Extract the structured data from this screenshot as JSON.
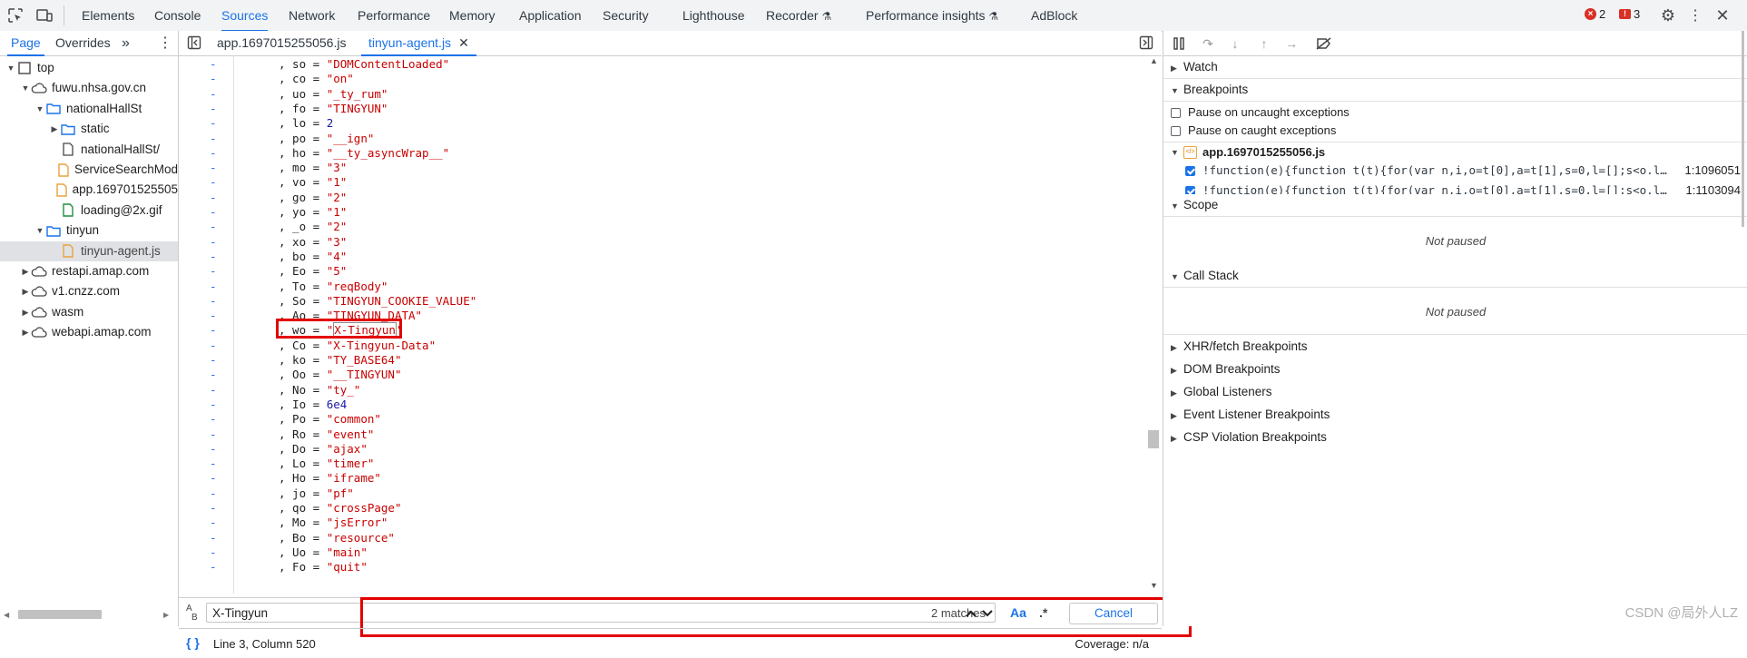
{
  "toolbar": {
    "tabs": [
      "Elements",
      "Console",
      "Sources",
      "Network",
      "Performance",
      "Memory",
      "Application",
      "Security",
      "Lighthouse",
      "Recorder",
      "Performance insights",
      "AdBlock"
    ],
    "active_tab": "Sources",
    "errors_count": "2",
    "issues_count": "3",
    "accent_color": "#1a73e8",
    "error_color": "#d93025"
  },
  "navigator": {
    "tabs": [
      "Page",
      "Overrides"
    ],
    "more": "»",
    "tree": [
      {
        "label": "top",
        "icon": "frame-icon",
        "depth": 0,
        "expanded": true
      },
      {
        "label": "fuwu.nhsa.gov.cn",
        "icon": "cloud-icon",
        "depth": 1,
        "expanded": true
      },
      {
        "label": "nationalHallSt",
        "icon": "folder-icon",
        "depth": 2,
        "expanded": true
      },
      {
        "label": "static",
        "icon": "folder-icon",
        "depth": 3,
        "expanded": false
      },
      {
        "label": "nationalHallSt/",
        "icon": "file-icon",
        "depth": 3
      },
      {
        "label": "ServiceSearchMod",
        "icon": "file-orange-icon",
        "depth": 3
      },
      {
        "label": "app.169701525505",
        "icon": "file-orange-icon",
        "depth": 3
      },
      {
        "label": "loading@2x.gif",
        "icon": "file-image-icon",
        "depth": 3
      },
      {
        "label": "tinyun",
        "icon": "folder-icon",
        "depth": 2,
        "expanded": true
      },
      {
        "label": "tinyun-agent.js",
        "icon": "file-orange-icon",
        "depth": 3,
        "selected": true
      },
      {
        "label": "restapi.amap.com",
        "icon": "cloud-icon",
        "depth": 1,
        "expanded": false
      },
      {
        "label": "v1.cnzz.com",
        "icon": "cloud-icon",
        "depth": 1,
        "expanded": false
      },
      {
        "label": "wasm",
        "icon": "cloud-icon",
        "depth": 1,
        "expanded": false
      },
      {
        "label": "webapi.amap.com",
        "icon": "cloud-icon",
        "depth": 1,
        "expanded": false
      }
    ]
  },
  "editor": {
    "files": [
      "app.1697015255056.js",
      "tinyun-agent.js"
    ],
    "active_file": "tinyun-agent.js",
    "gutter_mark": "-",
    "lines": [
      {
        "pre": ", so = ",
        "val": "\"DOMContentLoaded\"",
        "kind": "str"
      },
      {
        "pre": ", co = ",
        "val": "\"on\"",
        "kind": "str"
      },
      {
        "pre": ", uo = ",
        "val": "\"_ty_rum\"",
        "kind": "str"
      },
      {
        "pre": ", fo = ",
        "val": "\"TINGYUN\"",
        "kind": "str"
      },
      {
        "pre": ", lo = ",
        "val": "2",
        "kind": "num"
      },
      {
        "pre": ", po = ",
        "val": "\"__ign\"",
        "kind": "str"
      },
      {
        "pre": ", ho = ",
        "val": "\"__ty_asyncWrap__\"",
        "kind": "str"
      },
      {
        "pre": ", mo = ",
        "val": "\"3\"",
        "kind": "str"
      },
      {
        "pre": ", vo = ",
        "val": "\"1\"",
        "kind": "str"
      },
      {
        "pre": ", go = ",
        "val": "\"2\"",
        "kind": "str"
      },
      {
        "pre": ", yo = ",
        "val": "\"1\"",
        "kind": "str"
      },
      {
        "pre": ", _o = ",
        "val": "\"2\"",
        "kind": "str"
      },
      {
        "pre": ", xo = ",
        "val": "\"3\"",
        "kind": "str"
      },
      {
        "pre": ", bo = ",
        "val": "\"4\"",
        "kind": "str"
      },
      {
        "pre": ", Eo = ",
        "val": "\"5\"",
        "kind": "str"
      },
      {
        "pre": ", To = ",
        "val": "\"reqBody\"",
        "kind": "str"
      },
      {
        "pre": ", So = ",
        "val": "\"TINGYUN_COOKIE_VALUE\"",
        "kind": "str"
      },
      {
        "pre": ", Ao = ",
        "val": "\"TINGYUN_DATA\"",
        "kind": "str"
      },
      {
        "pre": ", wo = ",
        "val": "\"X-Tingyun\"",
        "kind": "str",
        "match": true
      },
      {
        "pre": ", Co = ",
        "val": "\"X-Tingyun-Data\"",
        "kind": "str"
      },
      {
        "pre": ", ko = ",
        "val": "\"TY_BASE64\"",
        "kind": "str"
      },
      {
        "pre": ", Oo = ",
        "val": "\"__TINGYUN\"",
        "kind": "str"
      },
      {
        "pre": ", No = ",
        "val": "\"ty_\"",
        "kind": "str"
      },
      {
        "pre": ", Io = ",
        "val": "6e4",
        "kind": "num"
      },
      {
        "pre": ", Po = ",
        "val": "\"common\"",
        "kind": "str"
      },
      {
        "pre": ", Ro = ",
        "val": "\"event\"",
        "kind": "str"
      },
      {
        "pre": ", Do = ",
        "val": "\"ajax\"",
        "kind": "str"
      },
      {
        "pre": ", Lo = ",
        "val": "\"timer\"",
        "kind": "str"
      },
      {
        "pre": ", Ho = ",
        "val": "\"iframe\"",
        "kind": "str"
      },
      {
        "pre": ", jo = ",
        "val": "\"pf\"",
        "kind": "str"
      },
      {
        "pre": ", qo = ",
        "val": "\"crossPage\"",
        "kind": "str"
      },
      {
        "pre": ", Mo = ",
        "val": "\"jsError\"",
        "kind": "str"
      },
      {
        "pre": ", Bo = ",
        "val": "\"resource\"",
        "kind": "str"
      },
      {
        "pre": ", Uo = ",
        "val": "\"main\"",
        "kind": "str"
      },
      {
        "pre": ", Fo = ",
        "val": "\"quit\"",
        "kind": "str"
      }
    ]
  },
  "search": {
    "query": "X-Tingyun",
    "matches": "2 matches",
    "match_case": "Aa",
    "regex": ".*",
    "cancel": "Cancel"
  },
  "status": {
    "position": "Line 3, Column 520",
    "coverage": "Coverage: n/a"
  },
  "debugger": {
    "watch": "Watch",
    "breakpoints": "Breakpoints",
    "pause_uncaught": "Pause on uncaught exceptions",
    "pause_caught": "Pause on caught exceptions",
    "bp_file": "app.1697015255056.js",
    "bp_items": [
      {
        "code": "!function(e){function t(t){for(var n,i,o=t[0],a=t[1],s=0,l=[];s<o.l…",
        "loc": "1:1096051"
      },
      {
        "code": "!function(e){function t(t){for(var n,i,o=t[0],a=t[1],s=0,l=[];s<o.l…",
        "loc": "1:1103094"
      }
    ],
    "scope": "Scope",
    "not_paused_1": "Not paused",
    "call_stack": "Call Stack",
    "not_paused_2": "Not paused",
    "sections": [
      "XHR/fetch Breakpoints",
      "DOM Breakpoints",
      "Global Listeners",
      "Event Listener Breakpoints",
      "CSP Violation Breakpoints"
    ]
  },
  "watermark": "CSDN @局外人LZ",
  "highlight_color": "#e30000"
}
